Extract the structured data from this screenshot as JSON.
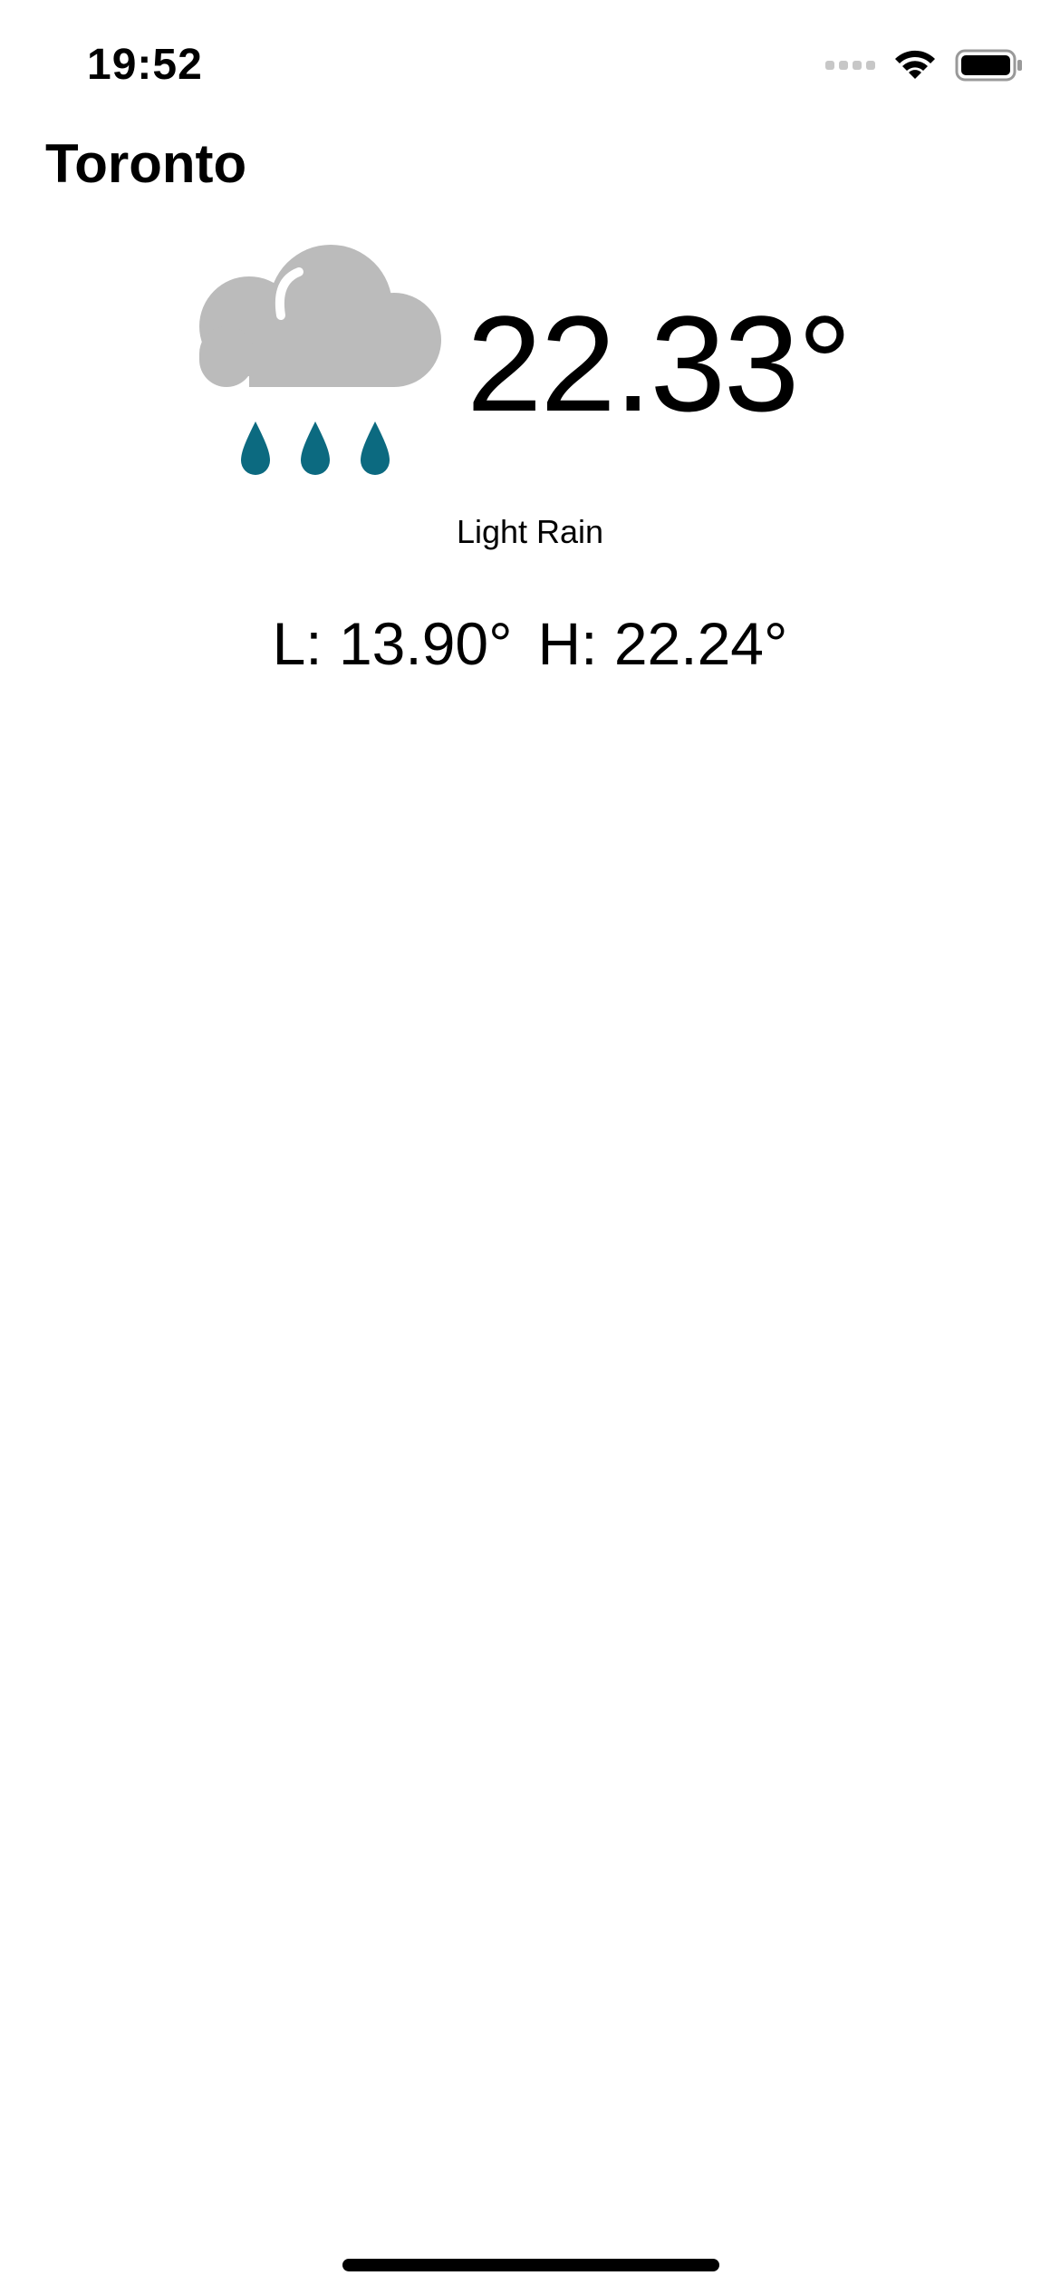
{
  "status_bar": {
    "time": "19:52",
    "icons": [
      "signal-icon",
      "wifi-icon",
      "battery-icon"
    ]
  },
  "city": "Toronto",
  "weather": {
    "icon": "cloud-rain-icon",
    "temperature": "22.33°",
    "condition": "Light Rain",
    "low": "L: 13.90°",
    "high": "H: 22.24°"
  },
  "colors": {
    "cloud": "#bbbbbb",
    "raindrop": "#0c6a80",
    "text": "#000000",
    "background": "#ffffff"
  }
}
